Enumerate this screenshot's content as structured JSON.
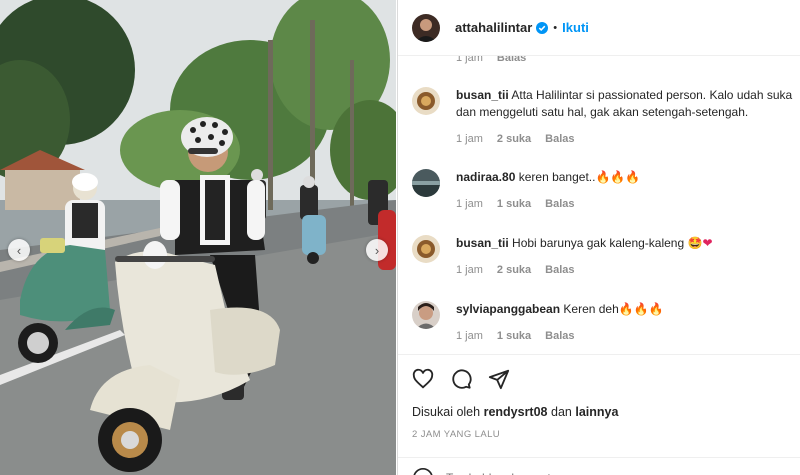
{
  "post": {
    "image_alt": "Rider on a white vintage Vespa scooter leading a group ride through a tree-lined road",
    "header": {
      "username": "attahalilintar",
      "dot": "•",
      "follow_label": "Ikuti"
    },
    "comments": [
      {
        "time": "1 jam",
        "likes": "",
        "reply": "Balas",
        "partial": true
      },
      {
        "username": "busan_tii",
        "text": "Atta Halilintar si passionated person. Kalo udah suka dan menggeluti satu hal, gak akan setengah-setengah.",
        "time": "1 jam",
        "likes": "2 suka",
        "reply": "Balas"
      },
      {
        "username": "nadiraa.80",
        "text": "keren banget..",
        "emoji": "🔥🔥🔥",
        "time": "1 jam",
        "likes": "1 suka",
        "reply": "Balas"
      },
      {
        "username": "busan_tii",
        "text": "Hobi barunya gak kaleng-kaleng",
        "emoji": "🤩❤",
        "time": "1 jam",
        "likes": "2 suka",
        "reply": "Balas"
      },
      {
        "username": "sylviapanggabean",
        "text": "Keren deh",
        "emoji": "🔥🔥🔥",
        "time": "1 jam",
        "likes": "1 suka",
        "reply": "Balas"
      }
    ],
    "liked_by": {
      "prefix": "Disukai oleh",
      "user": "rendysrt08",
      "connector": "dan",
      "others": "lainnya"
    },
    "date": "2 JAM YANG LALU",
    "add_comment_placeholder": "Tambahkan komentar..."
  },
  "icons": {
    "like": "heart-icon",
    "comment": "comment-icon",
    "share": "share-icon",
    "verified": "verified-badge-icon",
    "emoji": "emoji-icon",
    "nav_prev": "chevron-left-icon",
    "nav_next": "chevron-right-icon"
  },
  "colors": {
    "link": "#0095f6",
    "muted": "#8e8e8e",
    "text": "#262626",
    "verified": "#0095f6"
  }
}
